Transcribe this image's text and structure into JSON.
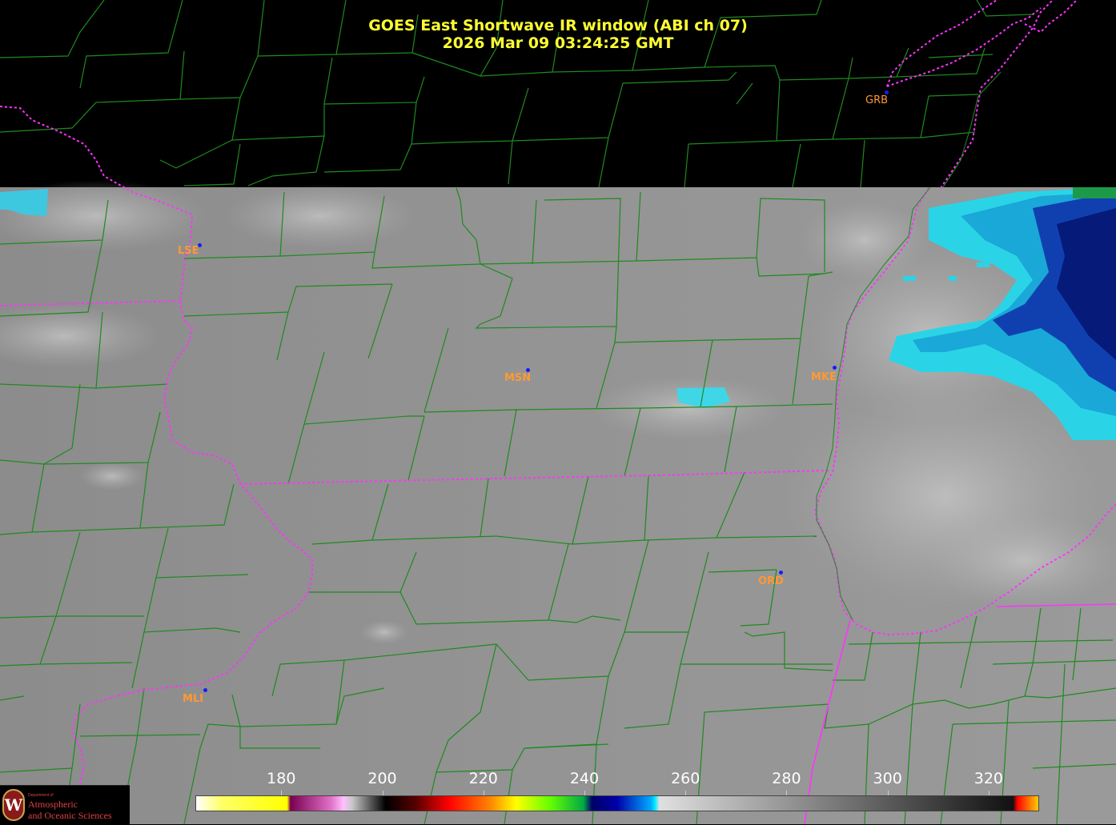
{
  "title": {
    "line1": "GOES East Shortwave IR window (ABI ch 07)",
    "line2": "2026 Mar 09  03:24:25 GMT"
  },
  "stations": [
    {
      "id": "GRB",
      "name": "GRB"
    },
    {
      "id": "LSE",
      "name": "LSE"
    },
    {
      "id": "MSN",
      "name": "MSN"
    },
    {
      "id": "MKE",
      "name": "MKE"
    },
    {
      "id": "ORD",
      "name": "ORD"
    },
    {
      "id": "MLI",
      "name": "MLI"
    }
  ],
  "colorbar": {
    "ticks": [
      "180",
      "200",
      "220",
      "240",
      "260",
      "280",
      "300",
      "320"
    ],
    "range": [
      163,
      330
    ]
  },
  "logo": {
    "small": "Department of",
    "line1": "Atmospheric",
    "line2": "and Oceanic Sciences",
    "seal_letter": "W"
  },
  "colors": {
    "title": "#ffff33",
    "station_label": "#ff9933",
    "county_lines": "#1f8a1f",
    "state_lines": "#ff33ff",
    "background": "#000000"
  }
}
